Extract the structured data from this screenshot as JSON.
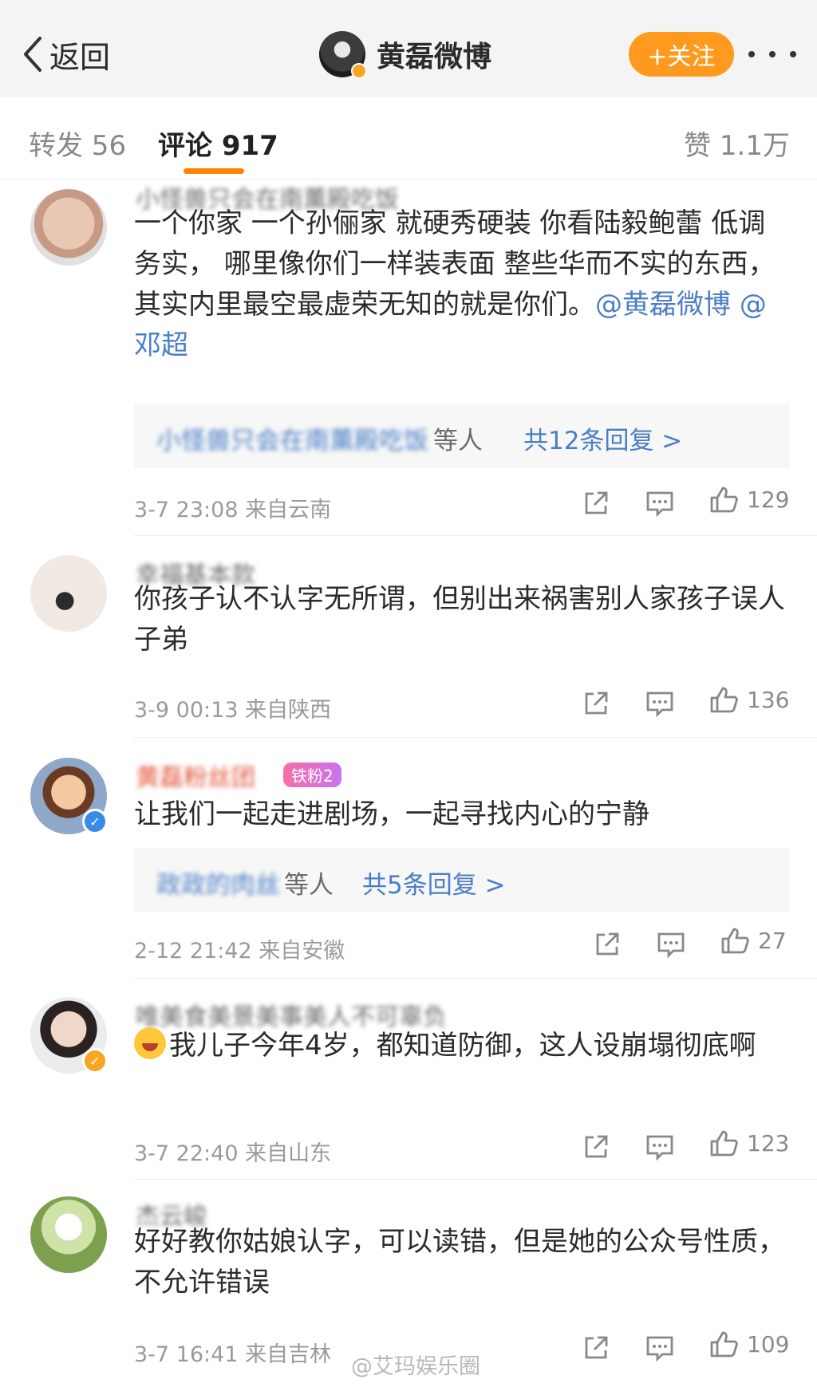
{
  "header": {
    "back_label": "返回",
    "title": "黄磊微博",
    "follow_label": "+关注"
  },
  "tabs": {
    "repost": "转发 56",
    "comments": "评论 917",
    "likes": "赞 1.1万"
  },
  "colors": {
    "accent": "#ff8200",
    "follow_button": "#ff9a1f",
    "link": "#4a7ec7",
    "verified_blue": "#3a8ae8",
    "verified_gold": "#f6a623"
  },
  "comments": [
    {
      "username": "小怪兽只会在南薰殿吃饭",
      "text": "一个你家 一个孙俪家 就硬秀硬装 你看陆毅鲍蕾 低调 务实， 哪里像你们一样装表面 整些华而不实的东西，其实内里最空最虚荣无知的就是你们。",
      "mention_1": "@黄磊微博",
      "mention_2": "@邓超",
      "reply_names": "小怪兽只会在南薰殿吃饭",
      "reply_suffix": "等人",
      "reply_count": "共12条回复 >",
      "time": "3-7 23:08",
      "location": "来自云南",
      "likes": "129"
    },
    {
      "username": "幸福基本款",
      "text": "你孩子认不认字无所谓，但别出来祸害别人家孩子误人子弟",
      "time": "3-9 00:13",
      "location": "来自陕西",
      "likes": "136"
    },
    {
      "username": "黄磊粉丝团",
      "fan_badge": "铁粉2",
      "text": "让我们一起走进剧场，一起寻找内心的宁静",
      "reply_names": "政政的肉丝",
      "reply_suffix": "等人",
      "reply_count": "共5条回复 >",
      "time": "2-12 21:42",
      "location": "来自安徽",
      "likes": "27"
    },
    {
      "username": "唯美食美景美事美人不可辜负",
      "text": "我儿子今年4岁，都知道防御，这人设崩塌彻底啊",
      "time": "3-7 22:40",
      "location": "来自山东",
      "likes": "123"
    },
    {
      "username": "杰云峻",
      "text": "好好教你姑娘认字，可以读错，但是她的公众号性质，不允许错误",
      "time": "3-7 16:41",
      "location": "来自吉林",
      "likes": "109"
    }
  ],
  "watermark": "@艾玛娱乐圈"
}
